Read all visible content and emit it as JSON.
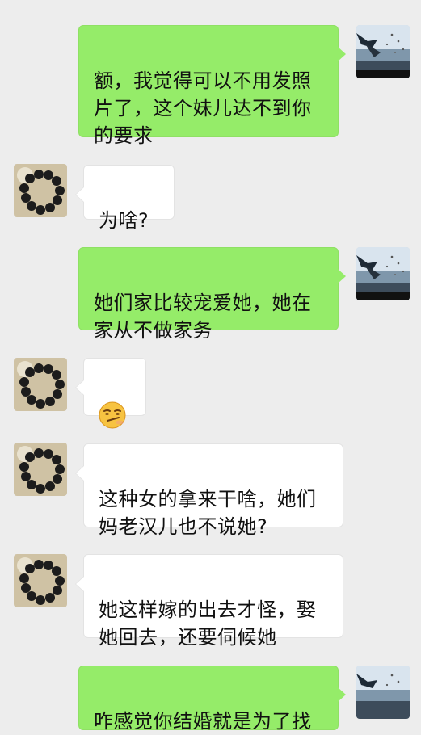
{
  "colors": {
    "background": "#ededed",
    "sent_bubble": "#95ec69",
    "received_bubble": "#ffffff"
  },
  "messages": [
    {
      "side": "right",
      "text": "额，我觉得可以不用发照片了，这个妹儿达不到你的要求"
    },
    {
      "side": "left",
      "text": "为啥?"
    },
    {
      "side": "right",
      "text": "她们家比较宠爱她，她在家从不做家务"
    },
    {
      "side": "left",
      "emoji": "smirk-face-emoji"
    },
    {
      "side": "left",
      "text": "这种女的拿来干啥，她们妈老汉儿也不说她?"
    },
    {
      "side": "left",
      "text": "她这样嫁的出去才怪，娶她回去，还要伺候她"
    },
    {
      "side": "right",
      "text": "咋感觉你结婚就是为了找"
    }
  ],
  "avatars": {
    "self": "seaside-photo-avatar",
    "contact": "prayer-beads-avatar"
  }
}
